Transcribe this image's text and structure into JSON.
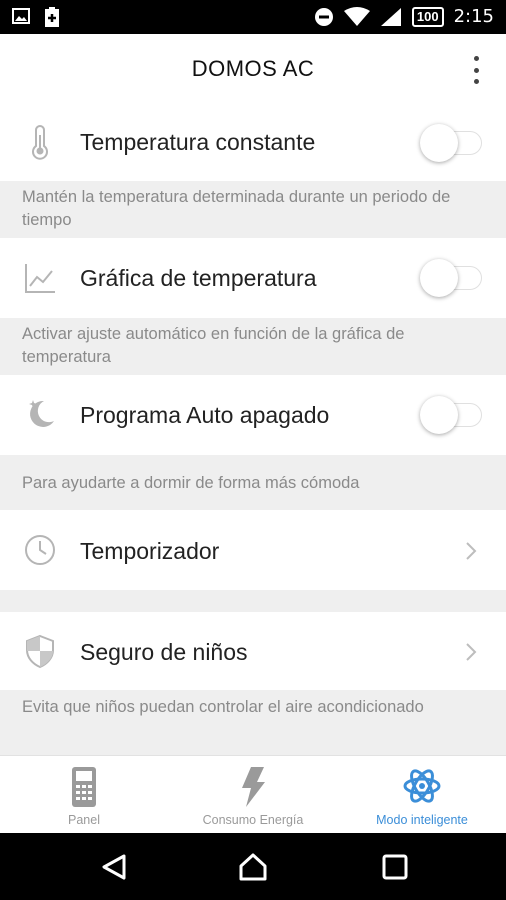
{
  "status_bar": {
    "battery": "100",
    "time": "2:15",
    "icons": [
      "image-icon",
      "battery-saver-icon",
      "do-not-disturb-icon",
      "wifi-icon",
      "signal-icon"
    ]
  },
  "header": {
    "title": "DOMOS AC",
    "menu_icon": "more-vert-icon"
  },
  "settings": {
    "constant_temp": {
      "label": "Temperatura constante",
      "icon": "thermometer-icon",
      "enabled": false,
      "description": "Mantén la temperatura determinada durante un periodo de tiempo"
    },
    "temp_graph": {
      "label": "Gráfica de temperatura",
      "icon": "chart-line-icon",
      "enabled": false,
      "description": "Activar ajuste automático en función de la gráfica de temperatura"
    },
    "auto_off": {
      "label": "Programa Auto apagado",
      "icon": "moon-stars-icon",
      "enabled": false,
      "description": "Para ayudarte a dormir de forma más cómoda"
    },
    "timer": {
      "label": "Temporizador",
      "icon": "clock-icon"
    },
    "child_lock": {
      "label": "Seguro de niños",
      "icon": "shield-icon",
      "description": "Evita que niños puedan controlar el aire acondicionado"
    }
  },
  "bottom_nav": {
    "items": [
      {
        "label": "Panel",
        "icon": "remote-control-icon",
        "active": false
      },
      {
        "label": "Consumo Energía",
        "icon": "lightning-icon",
        "active": false
      },
      {
        "label": "Modo inteligente",
        "icon": "atom-icon",
        "active": true
      }
    ]
  },
  "colors": {
    "accent": "#3b8ed8",
    "background": "#efefef",
    "icon_gray": "#b5b5b5"
  }
}
